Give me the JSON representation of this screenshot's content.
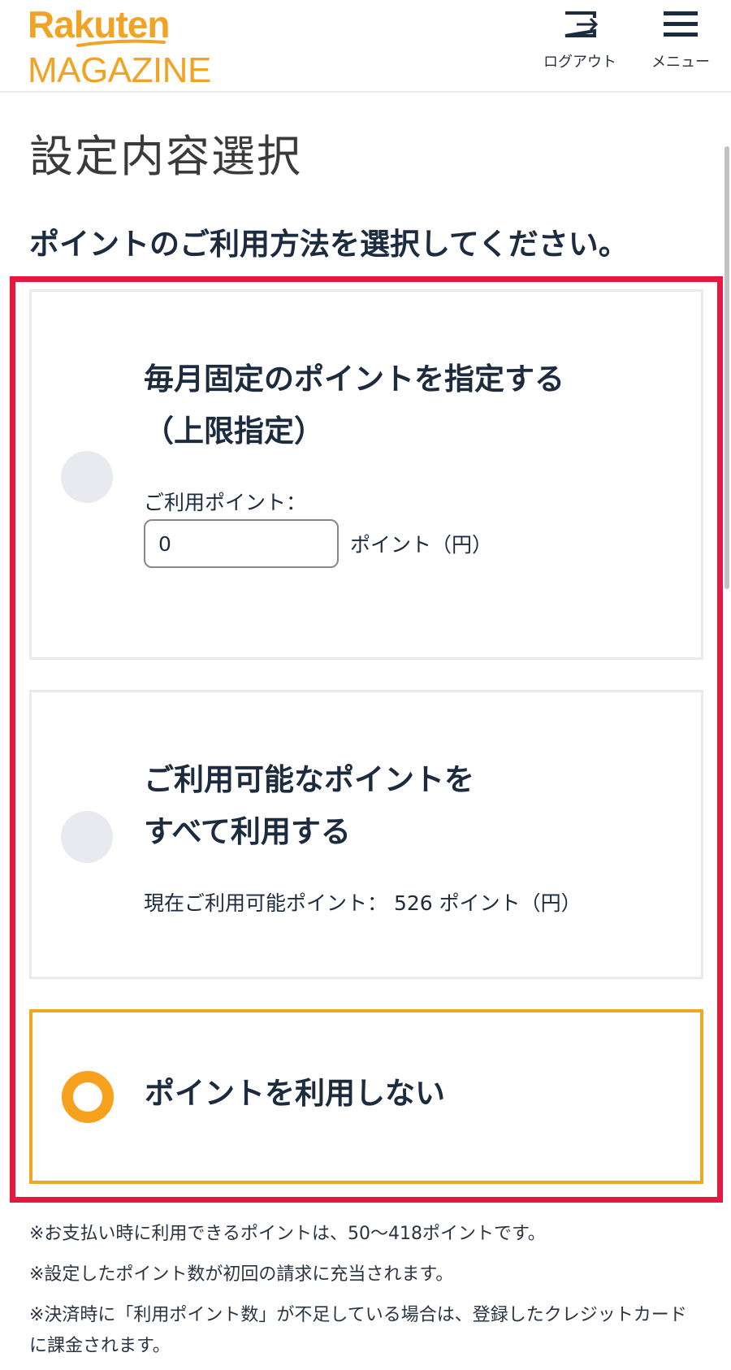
{
  "header": {
    "logo_brand": "Rakuten",
    "logo_product": "MAGAZINE",
    "logout_label": "ログアウト",
    "menu_label": "メニュー"
  },
  "page": {
    "title": "設定内容選択",
    "instruction": "ポイントのご利用方法を選択してください。"
  },
  "options": {
    "fixed": {
      "title_line1": "毎月固定のポイントを指定する",
      "title_line2": "（上限指定）",
      "points_label": "ご利用ポイント：",
      "points_value": "0",
      "points_unit": "ポイント（円）",
      "selected": false
    },
    "all": {
      "title_line1": "ご利用可能なポイントを",
      "title_line2": "すべて利用する",
      "available_label": "現在ご利用可能ポイント：",
      "available_value": "526",
      "available_unit": "ポイント（円）",
      "selected": false
    },
    "none": {
      "title": "ポイントを利用しない",
      "selected": true
    }
  },
  "notes": [
    "※お支払い時に利用できるポイントは、50〜418ポイントです。",
    "※設定したポイント数が初回の請求に充当されます。",
    "※決済時に「利用ポイント数」が不足している場合は、登録したクレジットカードに課金されます。"
  ],
  "colors": {
    "brand": "#f0a325",
    "highlight": "#e8173f",
    "selected_radio": "#f6a21e",
    "text": "#1c2b3d"
  }
}
